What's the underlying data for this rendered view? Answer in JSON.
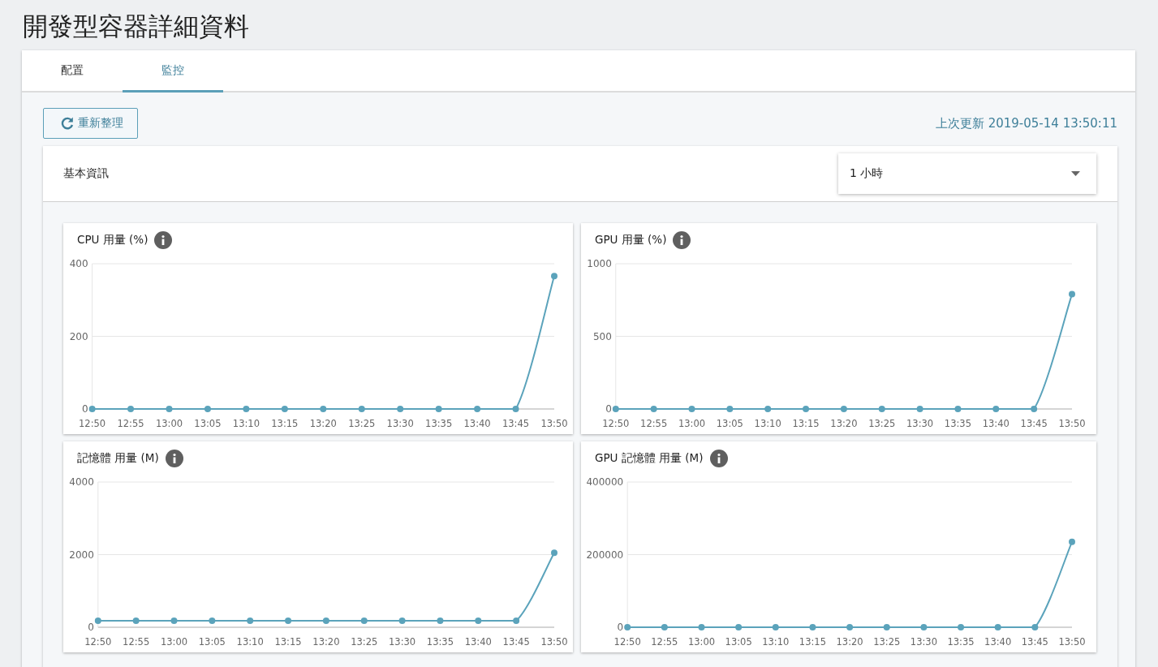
{
  "page_title": "開發型容器詳細資料",
  "tabs": [
    {
      "label": "配置",
      "selected": false
    },
    {
      "label": "監控",
      "selected": true
    }
  ],
  "refresh_button": "重新整理",
  "last_updated": "上次更新 2019-05-14 13:50:11",
  "panel": {
    "title": "基本資訊",
    "range_select": {
      "value": "1 小時"
    },
    "charts": [
      {
        "title": "CPU 用量 (%)",
        "chart_data": {
          "type": "line",
          "categories": [
            "12:50",
            "12:55",
            "13:00",
            "13:05",
            "13:10",
            "13:15",
            "13:20",
            "13:25",
            "13:30",
            "13:35",
            "13:40",
            "13:45",
            "13:50"
          ],
          "ylim": [
            0,
            400
          ],
          "yticks": [
            0,
            200,
            400
          ],
          "series": [
            {
              "color": "#5ba3bb",
              "marker": true,
              "values": [
                0,
                0,
                0,
                0,
                0,
                0,
                0,
                0,
                0,
                0,
                0,
                0,
                366
              ]
            }
          ]
        }
      },
      {
        "title": "GPU 用量 (%)",
        "chart_data": {
          "type": "line",
          "categories": [
            "12:50",
            "12:55",
            "13:00",
            "13:05",
            "13:10",
            "13:15",
            "13:20",
            "13:25",
            "13:30",
            "13:35",
            "13:40",
            "13:45",
            "13:50"
          ],
          "ylim": [
            0,
            1000
          ],
          "yticks": [
            0,
            500,
            1000
          ],
          "series": [
            {
              "color": "#5ba3bb",
              "marker": true,
              "values": [
                0,
                0,
                0,
                0,
                0,
                0,
                0,
                0,
                0,
                0,
                0,
                0,
                790
              ]
            }
          ]
        }
      },
      {
        "title": "記憶體 用量 (M)",
        "chart_data": {
          "type": "line",
          "categories": [
            "12:50",
            "12:55",
            "13:00",
            "13:05",
            "13:10",
            "13:15",
            "13:20",
            "13:25",
            "13:30",
            "13:35",
            "13:40",
            "13:45",
            "13:50"
          ],
          "ylim": [
            0,
            4000
          ],
          "yticks": [
            0,
            2000,
            4000
          ],
          "series": [
            {
              "color": "#5ba3bb",
              "marker": true,
              "values": [
                180,
                180,
                180,
                180,
                180,
                180,
                180,
                180,
                180,
                180,
                180,
                180,
                2050
              ]
            }
          ]
        }
      },
      {
        "title": "GPU 記憶體 用量 (M)",
        "chart_data": {
          "type": "line",
          "categories": [
            "12:50",
            "12:55",
            "13:00",
            "13:05",
            "13:10",
            "13:15",
            "13:20",
            "13:25",
            "13:30",
            "13:35",
            "13:40",
            "13:45",
            "13:50"
          ],
          "ylim": [
            0,
            400000
          ],
          "yticks": [
            0,
            200000,
            400000
          ],
          "series": [
            {
              "color": "#5ba3bb",
              "marker": true,
              "values": [
                0,
                0,
                0,
                0,
                0,
                0,
                0,
                0,
                0,
                0,
                0,
                0,
                235000
              ]
            }
          ]
        }
      }
    ]
  }
}
